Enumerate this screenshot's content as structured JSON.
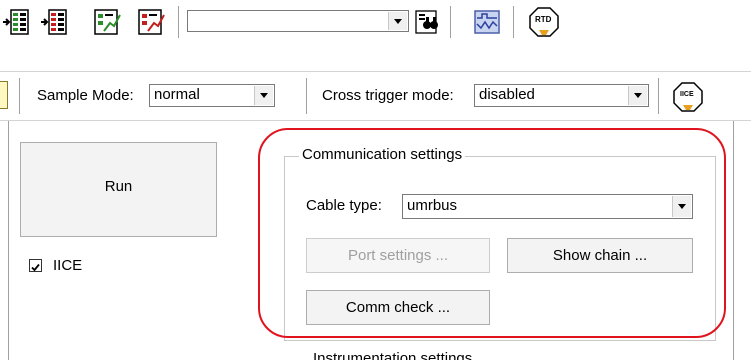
{
  "toolbar": {
    "icons": [
      "list-add-icon",
      "list-remove-icon",
      "chart-edit-icon",
      "chart-config-icon",
      "binoculars-icon",
      "waveform-icon",
      "rtd-icon"
    ],
    "combo_value": "",
    "rtd_label": "RTD"
  },
  "toolbar2": {
    "sample_mode_label": "Sample Mode:",
    "sample_mode_value": "normal",
    "cross_trigger_label": "Cross trigger mode:",
    "cross_trigger_value": "disabled",
    "iice_icon_label": "IICE"
  },
  "main": {
    "run_label": "Run",
    "iice_checkbox_label": "IICE",
    "iice_checked": true,
    "comm_group_title": "Communication settings",
    "cable_type_label": "Cable type:",
    "cable_type_value": "umrbus",
    "port_settings_label": "Port settings ...",
    "show_chain_label": "Show chain ...",
    "comm_check_label": "Comm check ...",
    "partial_label": "Instrumentation settings"
  },
  "colors": {
    "highlight": "#e0141e",
    "window_bg": "#ffffff"
  }
}
